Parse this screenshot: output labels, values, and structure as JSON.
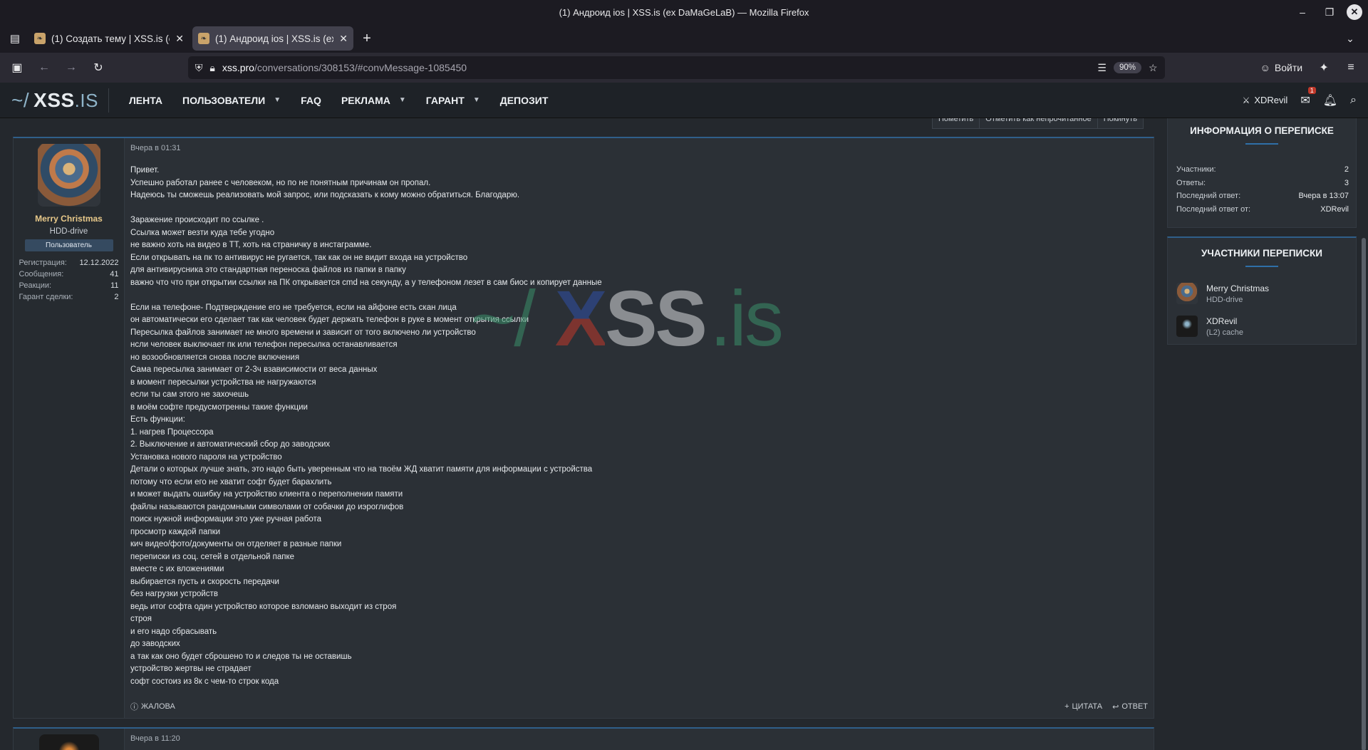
{
  "window": {
    "title": "(1) Андроид ios | XSS.is (ex DaMaGeLaB) — Mozilla Firefox"
  },
  "tabs": [
    {
      "label": "(1) Создать тему | XSS.is (ex",
      "active": false
    },
    {
      "label": "(1) Андроид ios | XSS.is (ex",
      "active": true
    }
  ],
  "urlbar": {
    "host": "xss.pro",
    "path": "/conversations/308153/#convMessage-1085450",
    "zoom": "90%"
  },
  "signin": {
    "label": "Войти"
  },
  "site": {
    "logo": {
      "tilde": "~/",
      "name": "XSS",
      "tld": ".IS"
    },
    "nav": [
      {
        "label": "ЛЕНТА",
        "dropdown": false
      },
      {
        "label": "ПОЛЬЗОВАТЕЛИ",
        "dropdown": true
      },
      {
        "label": "FAQ",
        "dropdown": false
      },
      {
        "label": "РЕКЛАМА",
        "dropdown": true
      },
      {
        "label": "ГАРАНТ",
        "dropdown": true
      },
      {
        "label": "ДЕПОЗИТ",
        "dropdown": false
      }
    ],
    "user": "XDRevil",
    "inbox_count": "1"
  },
  "conv_actions": [
    "Пометить",
    "Отметить как непрочитанное",
    "Покинуть"
  ],
  "message": {
    "author": {
      "name": "Merry Christmas",
      "title": "HDD-drive",
      "badge": "Пользователь",
      "stats": [
        {
          "label": "Регистрация:",
          "value": "12.12.2022"
        },
        {
          "label": "Сообщения:",
          "value": "41"
        },
        {
          "label": "Реакции:",
          "value": "11"
        },
        {
          "label": "Гарант сделки:",
          "value": "2"
        }
      ]
    },
    "date": "Вчера в 01:31",
    "lines": [
      "Привет.",
      "Успешно работал ранее с человеком, но по не понятным причинам он пропал.",
      "Надеюсь ты сможешь реализовать мой запрос, или подсказать к кому можно обратиться. Благодарю.",
      "",
      "Заражение происходит по ссылке .",
      "Ссылка может везти куда тебе угодно",
      "не важно хоть на видео в ТТ, хоть на страничку в инстаграмме.",
      "Если открывать на пк то антивирус не ругается, так как он не видит входа на устройство",
      "для антивирусника это стандартная переноска файлов из папки в папку",
      "важно что что при открытии ссылки на ПК открывается cmd на секунду, а у телефоном лезет в сам биос и копирует данные",
      "",
      "Если на телефоне- Подтверждение его не требуется, если на айфоне есть скан лица",
      "он автоматически его сделает так как человек будет держать телефон в руке в момент открытия ссылки",
      "Пересылка файлов занимает не много времени и зависит от того включено ли устройство",
      "нсли человек выключает пк или телефон пересылка останавливается",
      "но возообновляется снова после включения",
      "Сама пересылка занимает от 2-3ч взависимости от веса данных",
      "в момент пересылки устройства не нагружаются",
      "если ты сам этого не захочешь",
      "в моём софте предусмотренны такие функции",
      "Есть функции:",
      "1. нагрев Процессора",
      "2. Выключение и автоматический сбор до заводских",
      "Установка нового пароля на устройство",
      "Детали о которых лучше знать, это надо быть уверенным что на твоём ЖД хватит памяти для информации с устройства",
      "потому что если его не хватит софт будет барахлить",
      "и может выдать ошибку на устройство клиента о переполнении памяти",
      "файлы называются рандомными символами от собачки до иэроглифов",
      "поиск нужной информации это уже ручная работа",
      "просмотр каждой папки",
      "кич видео/фото/документы он отделяет в разные папки",
      "переписки из соц. сетей в отдельной папке",
      "вместе с их вложениями",
      "выбирается пусть и скорость передачи",
      "без нагрузки устройств",
      "ведь итог софта один устройство которое взломано выходит из строя",
      "строя",
      "и его надо сбрасывать",
      "до заводских",
      "а так как оно будет сброшено то и следов ты не оставишь",
      "устройство жертвы не страдает",
      "софт состоиз из 8к с чем-то строк кода"
    ],
    "report": "ЖАЛОВА",
    "quote": "ЦИТАТА",
    "reply": "ОТВЕТ"
  },
  "message2": {
    "date": "Вчера в 11:20"
  },
  "watermark": {
    "tilde": "~/",
    "x": "X",
    "ss": "SS",
    "tld": ".is"
  },
  "sidebar": {
    "info_title": "ИНФОРМАЦИЯ О ПЕРЕПИСКЕ",
    "info_rows": [
      {
        "label": "Участники:",
        "value": "2"
      },
      {
        "label": "Ответы:",
        "value": "3"
      },
      {
        "label": "Последний ответ:",
        "value": "Вчера в 13:07"
      },
      {
        "label": "Последний ответ от:",
        "value": "XDRevil"
      }
    ],
    "participants_title": "УЧАСТНИКИ ПЕРЕПИСКИ",
    "participants": [
      {
        "name": "Merry Christmas",
        "role": "HDD-drive"
      },
      {
        "name": "XDRevil",
        "role": "(L2) cache"
      }
    ]
  }
}
